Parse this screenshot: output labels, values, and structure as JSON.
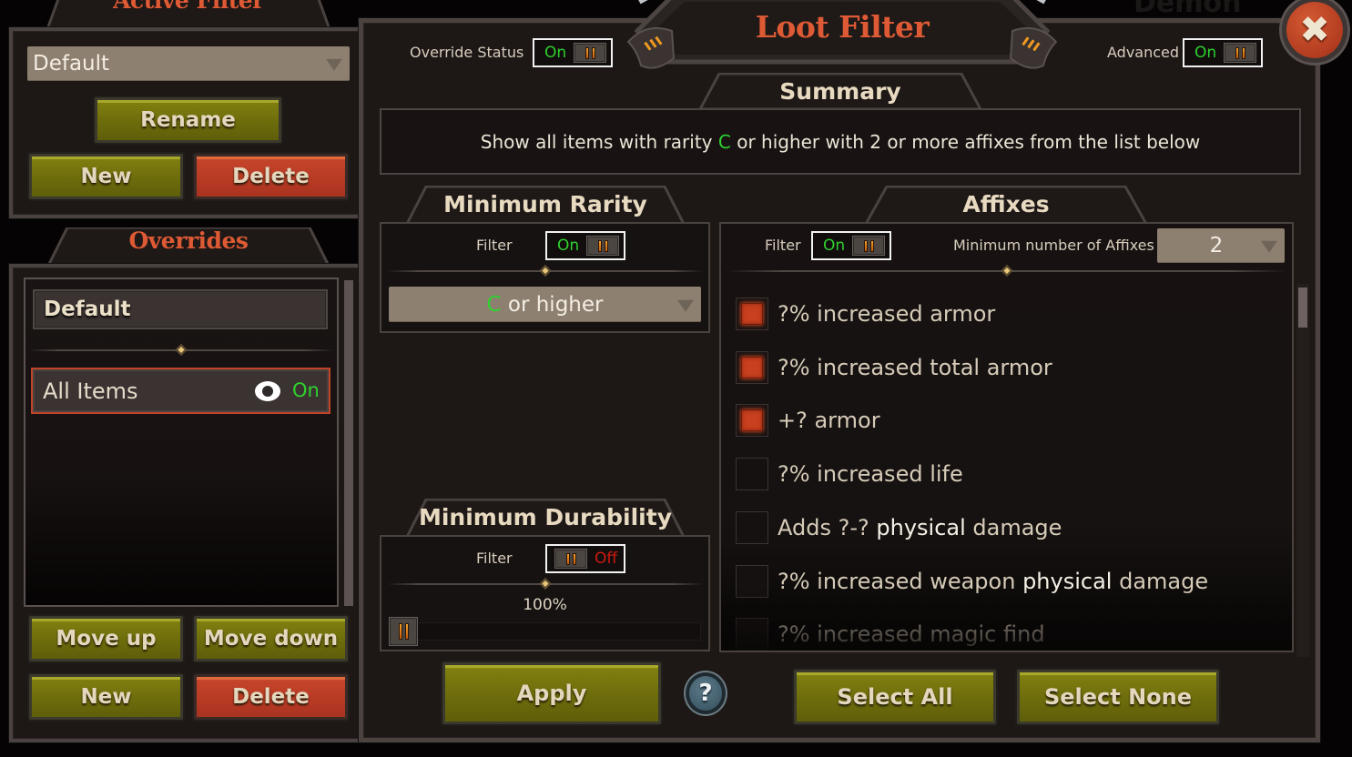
{
  "background": {
    "ghost_text": "Demon"
  },
  "active_filter": {
    "title": "Active Filter",
    "selected": "Default",
    "rename_label": "Rename",
    "new_label": "New",
    "delete_label": "Delete"
  },
  "overrides": {
    "title": "Overrides",
    "items": [
      {
        "label": "Default"
      },
      {
        "label": "All Items",
        "status": "On",
        "visible": true,
        "selected": true
      }
    ],
    "move_up_label": "Move up",
    "move_down_label": "Move down",
    "new_label": "New",
    "delete_label": "Delete"
  },
  "loot_filter": {
    "title": "Loot Filter",
    "override_status_label": "Override Status",
    "override_status_value": "On",
    "advanced_label": "Advanced",
    "advanced_value": "On",
    "close_label": "Close"
  },
  "summary": {
    "title": "Summary",
    "text_before": "Show all items with rarity ",
    "rarity": "C",
    "text_after": " or higher with 2 or more affixes from the list below"
  },
  "minimum_rarity": {
    "title": "Minimum Rarity",
    "filter_label": "Filter",
    "filter_value": "On",
    "selected_rarity": "C",
    "selected_suffix": " or higher"
  },
  "minimum_durability": {
    "title": "Minimum Durability",
    "filter_label": "Filter",
    "filter_value": "Off",
    "value_text": "100%",
    "slider_fraction": 0.0
  },
  "affixes": {
    "title": "Affixes",
    "filter_label": "Filter",
    "filter_value": "On",
    "min_count_label": "Minimum number of Affixes",
    "min_count_value": "2",
    "items": [
      {
        "parts": [
          "?% increased armor"
        ],
        "checked": true
      },
      {
        "parts": [
          "?% increased total armor"
        ],
        "checked": true
      },
      {
        "parts": [
          "+? armor"
        ],
        "checked": true
      },
      {
        "parts": [
          "?% increased life"
        ],
        "checked": false
      },
      {
        "parts": [
          "Adds ?-? ",
          "physical",
          " damage"
        ],
        "checked": false
      },
      {
        "parts": [
          "?% increased weapon ",
          "physical",
          " damage"
        ],
        "checked": false
      },
      {
        "parts": [
          "?% increased magic find"
        ],
        "checked": false
      }
    ]
  },
  "footer": {
    "apply_label": "Apply",
    "help_label": "?",
    "select_all_label": "Select All",
    "select_none_label": "Select None"
  },
  "colors": {
    "title_orange": "#dd5a34",
    "on_green": "#2ed12e",
    "off_red": "#cc1a10",
    "button_olive": "#7e7e10",
    "button_red": "#c4442a",
    "checkbox_checked": "#c8401e"
  }
}
